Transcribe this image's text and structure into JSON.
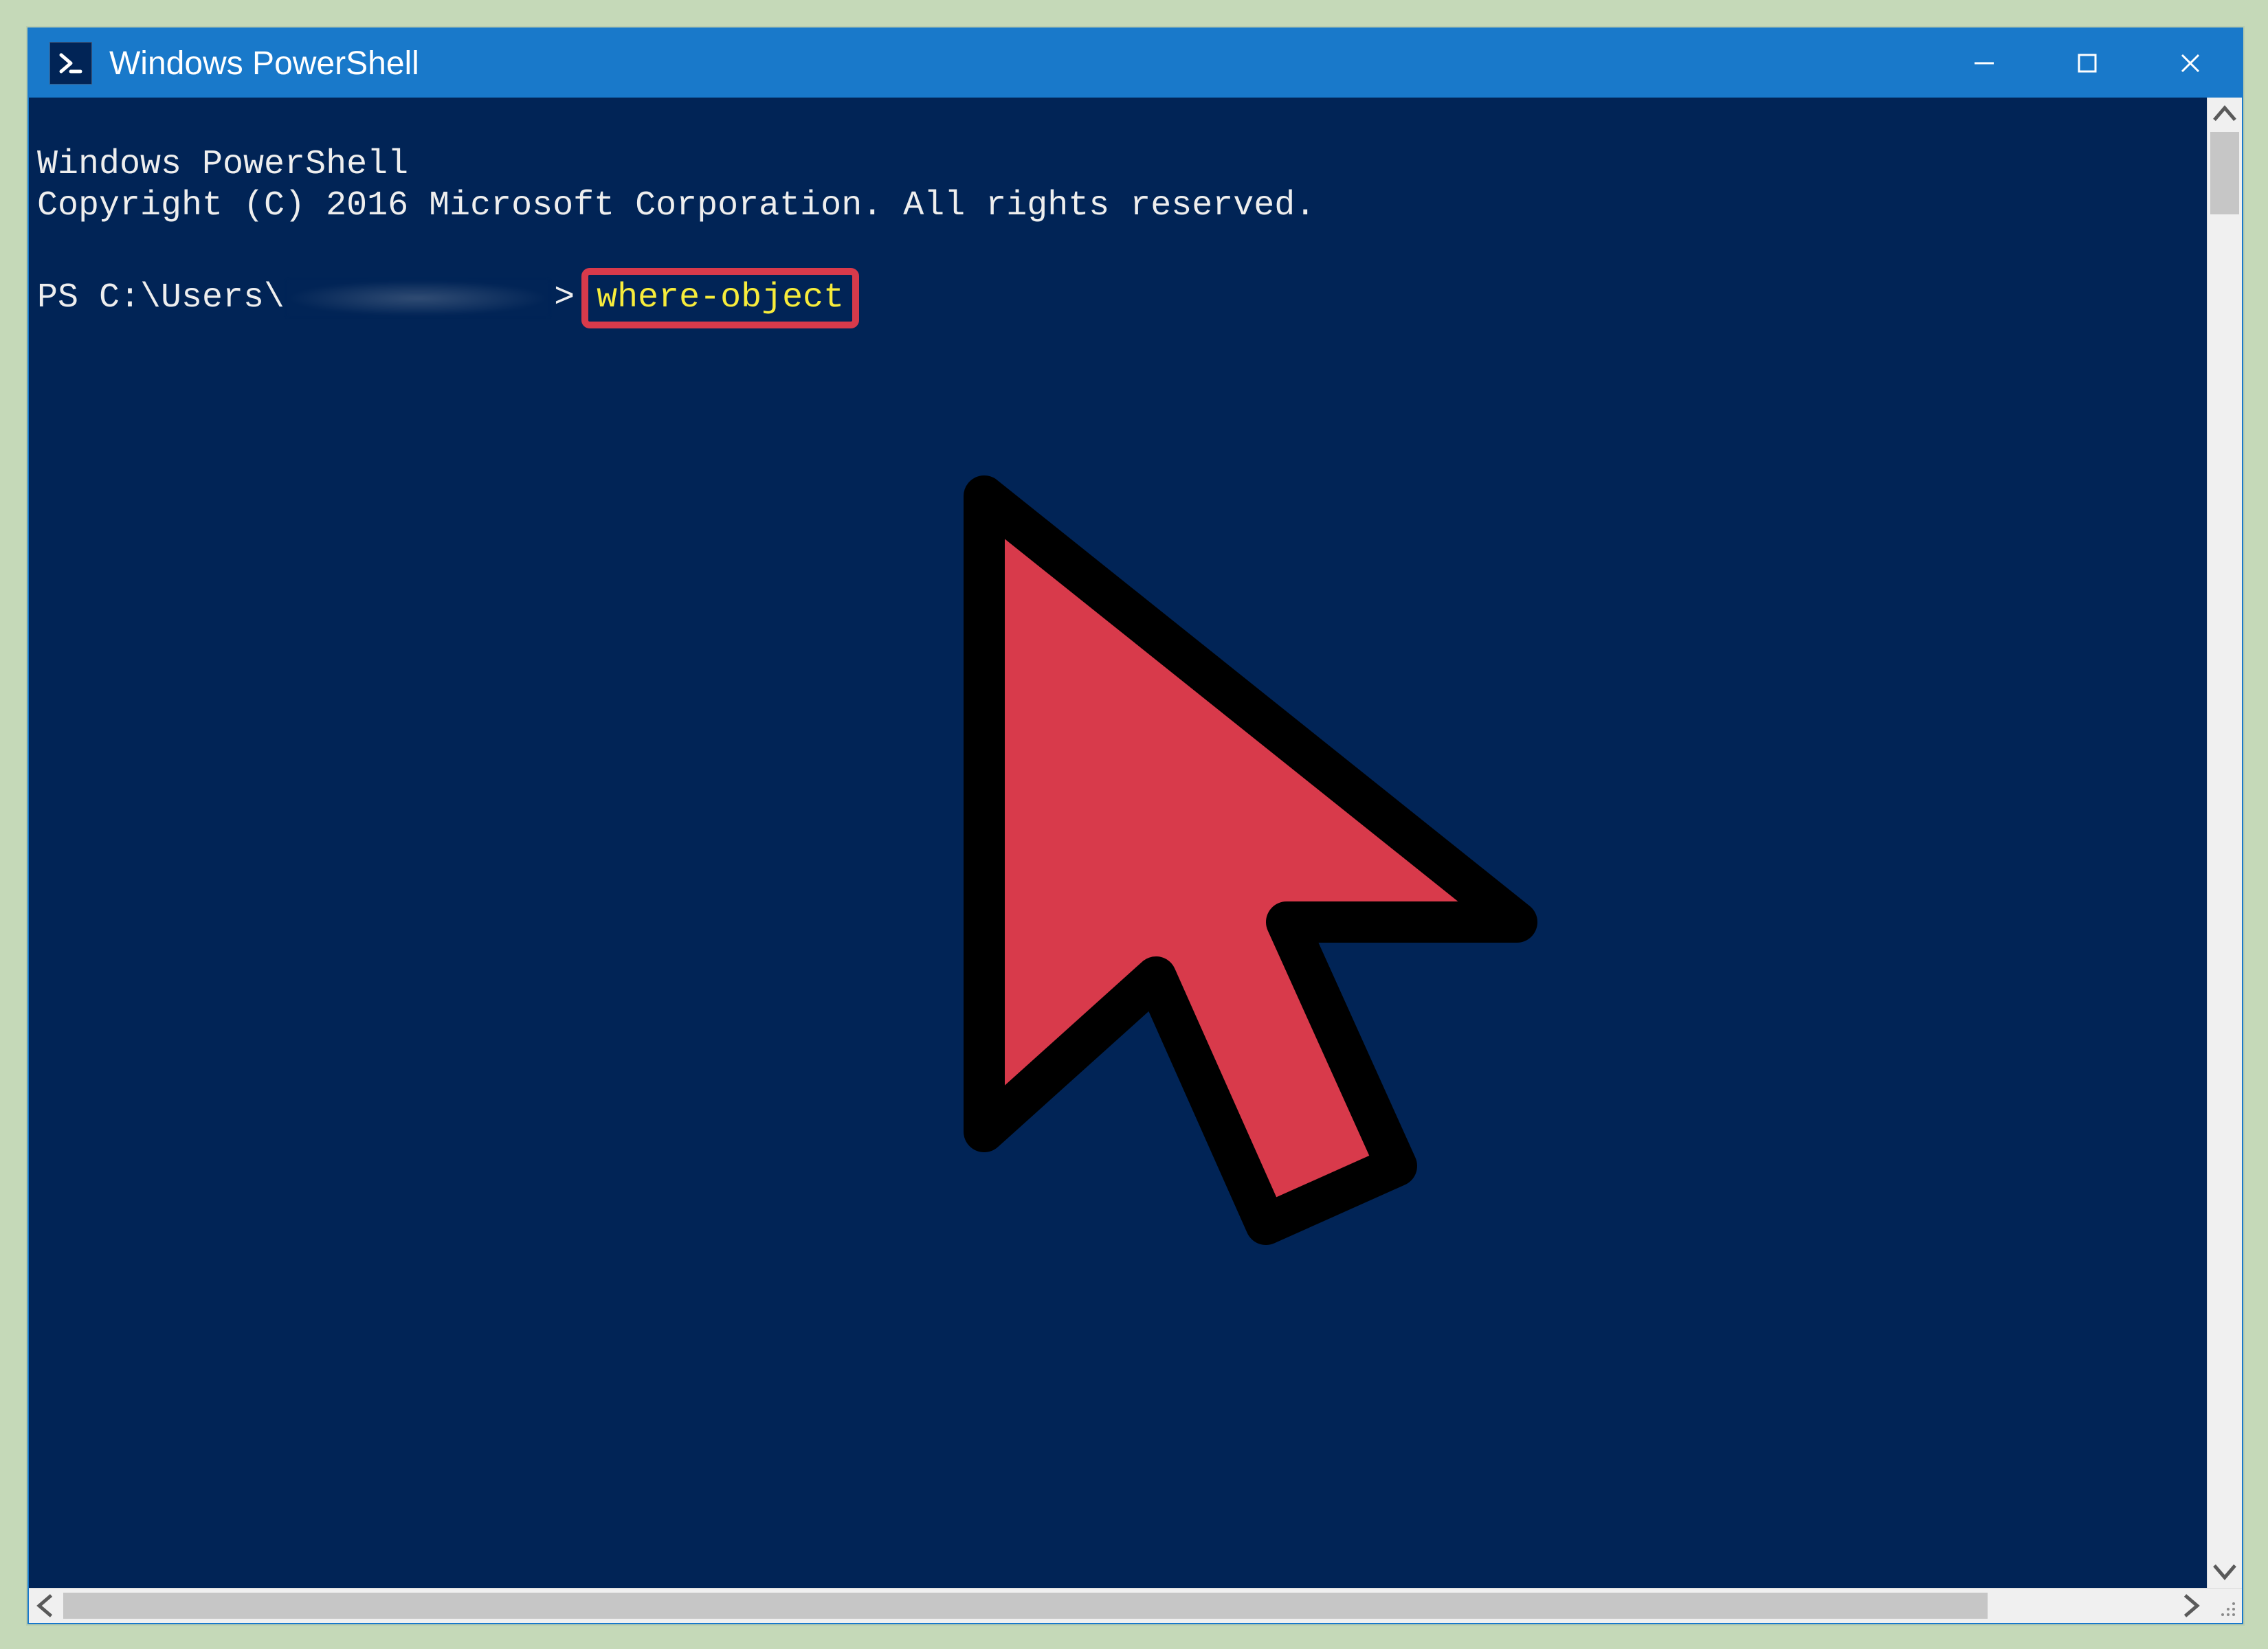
{
  "window": {
    "title": "Windows PowerShell"
  },
  "console": {
    "line1": "Windows PowerShell",
    "line2": "Copyright (C) 2016 Microsoft Corporation. All rights reserved.",
    "prompt_prefix": "PS C:\\Users\\",
    "prompt_gt": ">",
    "command": "where-object"
  },
  "colors": {
    "titlebar": "#1979ca",
    "console_bg": "#012456",
    "console_fg": "#eeeeee",
    "command_fg": "#f7ec3b",
    "highlight_border": "#d83a4b",
    "page_bg": "#c5d9b8"
  },
  "icons": {
    "app": "powershell-icon",
    "minimize": "minimize-icon",
    "maximize": "maximize-icon",
    "close": "close-icon",
    "scroll_up": "chevron-up-icon",
    "scroll_down": "chevron-down-icon",
    "scroll_left": "chevron-left-icon",
    "scroll_right": "chevron-right-icon",
    "resize": "resize-grip-icon",
    "cursor": "cursor-arrow-icon"
  }
}
